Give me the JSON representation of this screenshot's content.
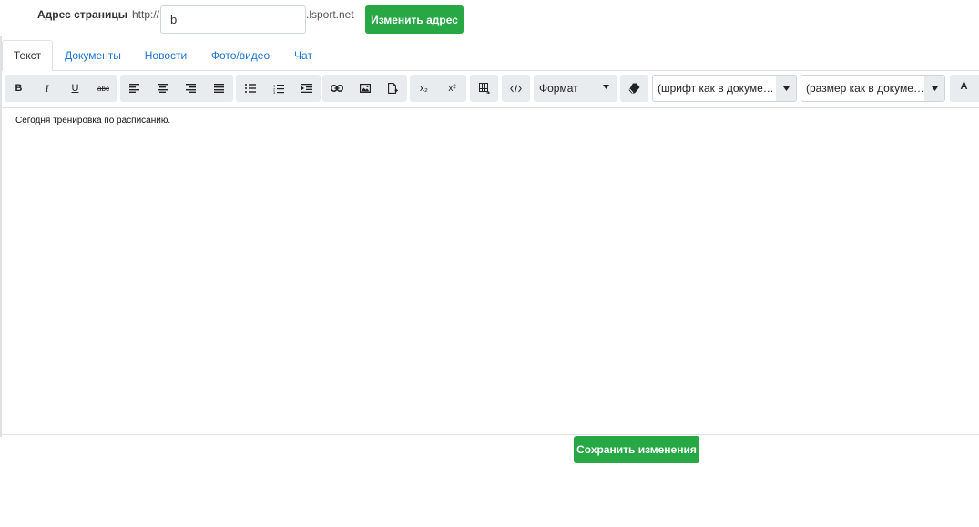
{
  "address": {
    "label": "Адрес страницы",
    "prefix": "http://",
    "value": "b",
    "suffix": ".lsport.net",
    "change_button": "Изменить адрес"
  },
  "tabs": [
    {
      "label": "Текст",
      "active": true
    },
    {
      "label": "Документы",
      "active": false
    },
    {
      "label": "Новости",
      "active": false
    },
    {
      "label": "Фото/видео",
      "active": false
    },
    {
      "label": "Чат",
      "active": false
    }
  ],
  "toolbar": {
    "bold": "B",
    "italic": "I",
    "underline": "U",
    "strike": "abc",
    "subscript": "x₂",
    "superscript": "x²",
    "format_select": "Формат",
    "font_select": "(шрифт как в документе)",
    "size_select": "(размер как в документе)",
    "font_color": "A"
  },
  "icons": [
    "align-left-icon",
    "align-center-icon",
    "align-right-icon",
    "align-justify-icon",
    "bullet-list-icon",
    "numbered-list-icon",
    "indent-icon",
    "link-icon",
    "image-icon",
    "file-icon",
    "table-icon",
    "code-icon",
    "eraser-icon",
    "chevron-down-icon"
  ],
  "editor": {
    "content": "Сегодня тренировка по расписанию."
  },
  "save_button": "Сохранить изменения",
  "colors": {
    "accent_green": "#28a745",
    "link_blue": "#1e74d2",
    "toolbar_bg": "#e9ecef"
  }
}
